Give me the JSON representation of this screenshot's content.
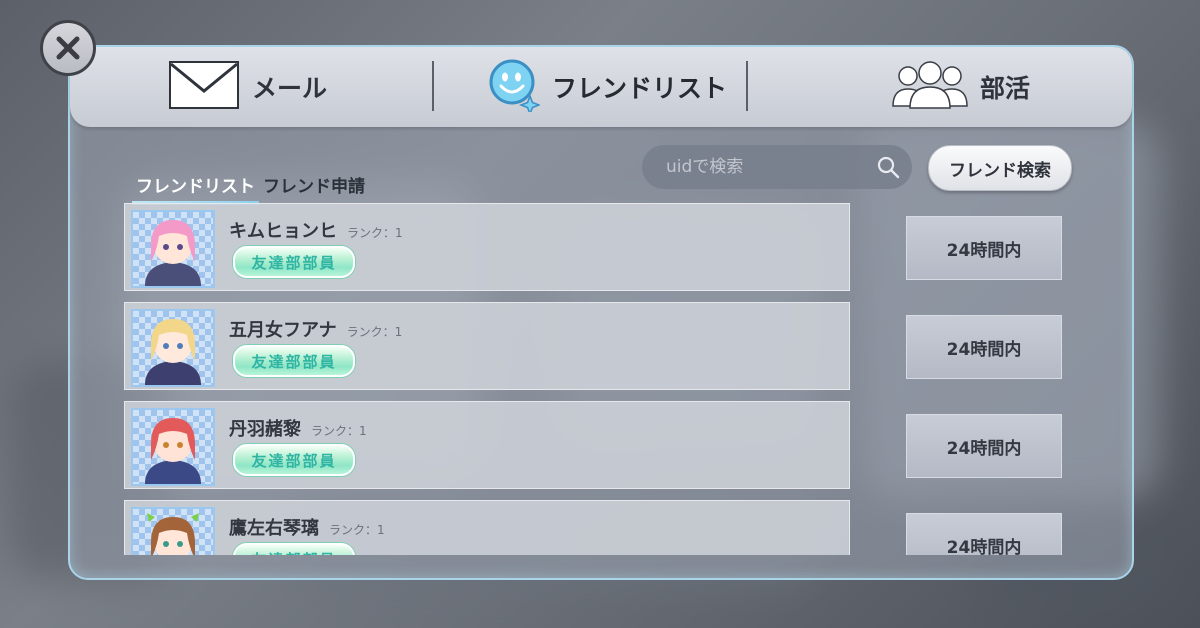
{
  "tabs": {
    "mail": "メール",
    "friend_list": "フレンドリスト",
    "club": "部活"
  },
  "subtabs": {
    "friend_list": "フレンドリスト",
    "friend_requests": "フレンド申請"
  },
  "search": {
    "placeholder": "uidで検索",
    "button_label": "フレンド検索"
  },
  "friends": [
    {
      "name": "キムヒョンヒ",
      "rank": "ランク：1",
      "badge": "友達部部員",
      "time": "24時間内",
      "hair": "#f39ac8"
    },
    {
      "name": "五月女フアナ",
      "rank": "ランク：1",
      "badge": "友達部部員",
      "time": "24時間内",
      "hair": "#f2d68a"
    },
    {
      "name": "丹羽赭黎",
      "rank": "ランク：1",
      "badge": "友達部部員",
      "time": "24時間内",
      "hair": "#e25a5a"
    },
    {
      "name": "鷹左右琴璃",
      "rank": "ランク：1",
      "badge": "友達部部員",
      "time": "24時間内",
      "hair": "#a3643a"
    }
  ],
  "colors": {
    "panel_border": "#a9d4ea",
    "badge_text": "#2fb5a3",
    "active_subtab_underline": "#8fd0ec"
  },
  "icons": {
    "close": "close-icon",
    "mail": "mail-envelope-icon",
    "friends": "smiley-face-icon",
    "club": "group-people-icon",
    "search": "search-icon"
  }
}
